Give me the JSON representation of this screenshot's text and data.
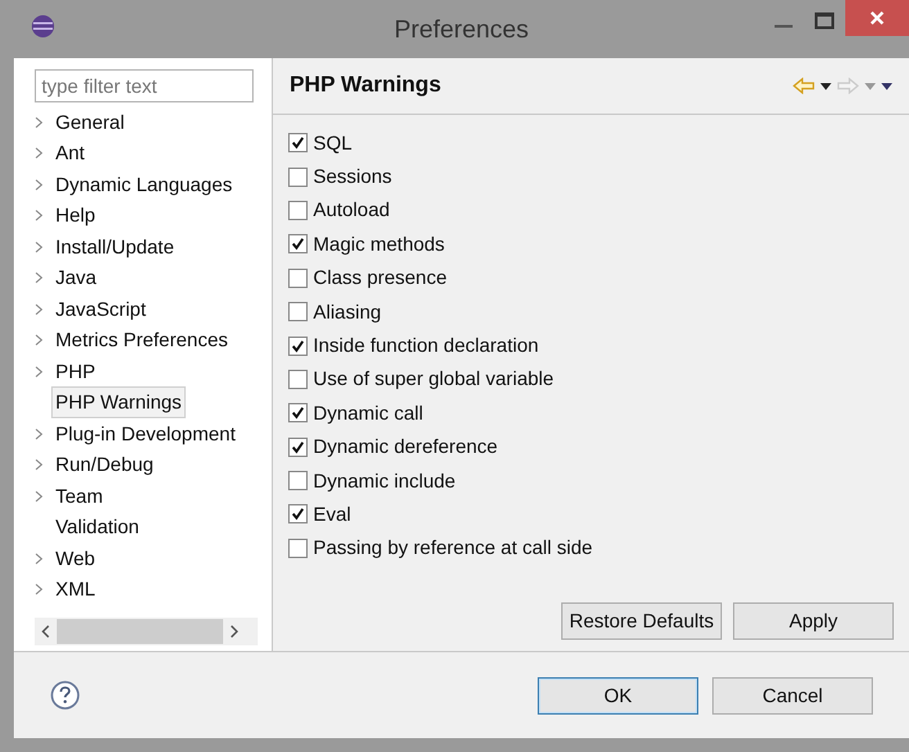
{
  "window": {
    "title": "Preferences"
  },
  "filter": {
    "placeholder": "type filter text"
  },
  "tree": [
    {
      "label": "General",
      "expandable": true,
      "selected": false
    },
    {
      "label": "Ant",
      "expandable": true,
      "selected": false
    },
    {
      "label": "Dynamic Languages",
      "expandable": true,
      "selected": false
    },
    {
      "label": "Help",
      "expandable": true,
      "selected": false
    },
    {
      "label": "Install/Update",
      "expandable": true,
      "selected": false
    },
    {
      "label": "Java",
      "expandable": true,
      "selected": false
    },
    {
      "label": "JavaScript",
      "expandable": true,
      "selected": false
    },
    {
      "label": "Metrics Preferences",
      "expandable": true,
      "selected": false
    },
    {
      "label": "PHP",
      "expandable": true,
      "selected": false
    },
    {
      "label": "PHP Warnings",
      "expandable": false,
      "selected": true
    },
    {
      "label": "Plug-in Development",
      "expandable": true,
      "selected": false
    },
    {
      "label": "Run/Debug",
      "expandable": true,
      "selected": false
    },
    {
      "label": "Team",
      "expandable": true,
      "selected": false
    },
    {
      "label": "Validation",
      "expandable": false,
      "selected": false
    },
    {
      "label": "Web",
      "expandable": true,
      "selected": false
    },
    {
      "label": "XML",
      "expandable": true,
      "selected": false
    }
  ],
  "page": {
    "title": "PHP Warnings"
  },
  "options": [
    {
      "label": "SQL",
      "checked": true
    },
    {
      "label": "Sessions",
      "checked": false
    },
    {
      "label": "Autoload",
      "checked": false
    },
    {
      "label": "Magic methods",
      "checked": true
    },
    {
      "label": "Class presence",
      "checked": false
    },
    {
      "label": "Aliasing",
      "checked": false
    },
    {
      "label": "Inside function declaration",
      "checked": true
    },
    {
      "label": "Use of super global variable",
      "checked": false
    },
    {
      "label": "Dynamic call",
      "checked": true
    },
    {
      "label": "Dynamic dereference",
      "checked": true
    },
    {
      "label": "Dynamic include",
      "checked": false
    },
    {
      "label": "Eval",
      "checked": true
    },
    {
      "label": "Passing by reference at call side",
      "checked": false
    }
  ],
  "page_buttons": [
    "Restore Defaults",
    "Apply"
  ],
  "dialog_buttons": [
    {
      "label": "OK",
      "default": true
    },
    {
      "label": "Cancel",
      "default": false
    }
  ]
}
